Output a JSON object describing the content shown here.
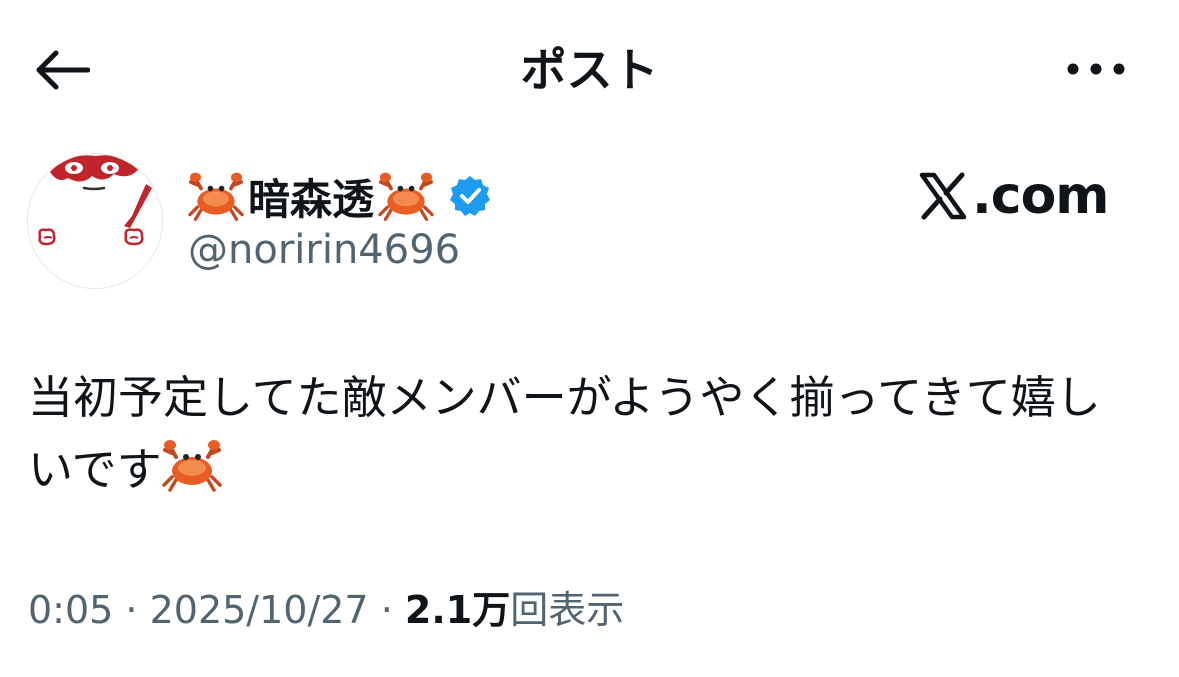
{
  "header": {
    "title": "ポスト"
  },
  "author": {
    "display_name": "暗森透",
    "handle": "@noririn4696",
    "verified": true,
    "name_decoration_icon": "crab-emoji"
  },
  "watermark": {
    "text": ".com",
    "logo_icon": "x-logo"
  },
  "post": {
    "text": "当初予定してた敵メンバーがようやく揃ってきて嬉しいです",
    "trailing_emoji": "crab-emoji"
  },
  "meta": {
    "time": "0:05",
    "separator": " · ",
    "date": "2025/10/27",
    "views_count": "2.1万",
    "views_label": "回表示"
  },
  "colors": {
    "text_primary": "#0f1419",
    "text_secondary": "#536471",
    "verified_blue": "#1d9bf0",
    "avatar_red": "#c0242a"
  }
}
